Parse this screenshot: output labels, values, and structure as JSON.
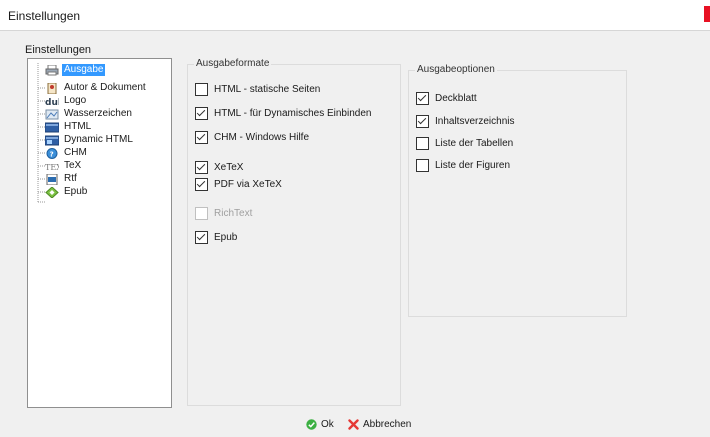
{
  "window": {
    "title": "Einstellungen"
  },
  "settings_label": "Einstellungen",
  "tree": {
    "items": [
      {
        "label": "Ausgabe",
        "icon": "printer-icon",
        "selected": true
      },
      {
        "label": "Autor & Dokument",
        "icon": "document-icon"
      },
      {
        "label": "Logo",
        "icon": "logo-icon"
      },
      {
        "label": "Wasserzeichen",
        "icon": "watermark-icon"
      },
      {
        "label": "HTML",
        "icon": "html-icon"
      },
      {
        "label": "Dynamic HTML",
        "icon": "dynamic-html-icon"
      },
      {
        "label": "CHM",
        "icon": "chm-help-icon"
      },
      {
        "label": "TeX",
        "icon": "tex-icon"
      },
      {
        "label": "Rtf",
        "icon": "rtf-icon"
      },
      {
        "label": "Epub",
        "icon": "epub-icon"
      }
    ]
  },
  "formats": {
    "title": "Ausgabeformate",
    "options": [
      {
        "label": "HTML - statische Seiten",
        "checked": false
      },
      {
        "label": "HTML - für Dynamisches Einbinden",
        "checked": true
      },
      {
        "label": "CHM - Windows Hilfe",
        "checked": true
      },
      {
        "label": "XeTeX",
        "checked": true
      },
      {
        "label": "PDF via XeTeX",
        "checked": true
      },
      {
        "label": "RichText",
        "checked": false,
        "disabled": true
      },
      {
        "label": "Epub",
        "checked": true
      }
    ]
  },
  "output_options": {
    "title": "Ausgabeoptionen",
    "options": [
      {
        "label": "Deckblatt",
        "checked": true
      },
      {
        "label": "Inhaltsverzeichnis",
        "checked": true
      },
      {
        "label": "Liste der Tabellen",
        "checked": false
      },
      {
        "label": "Liste der Figuren",
        "checked": false
      }
    ]
  },
  "footer": {
    "ok_label": "Ok",
    "cancel_label": "Abbrechen"
  },
  "colors": {
    "selection": "#3399ff",
    "ok_green": "#3cb043",
    "cancel_red": "#e53935",
    "close_red": "#e81123"
  }
}
